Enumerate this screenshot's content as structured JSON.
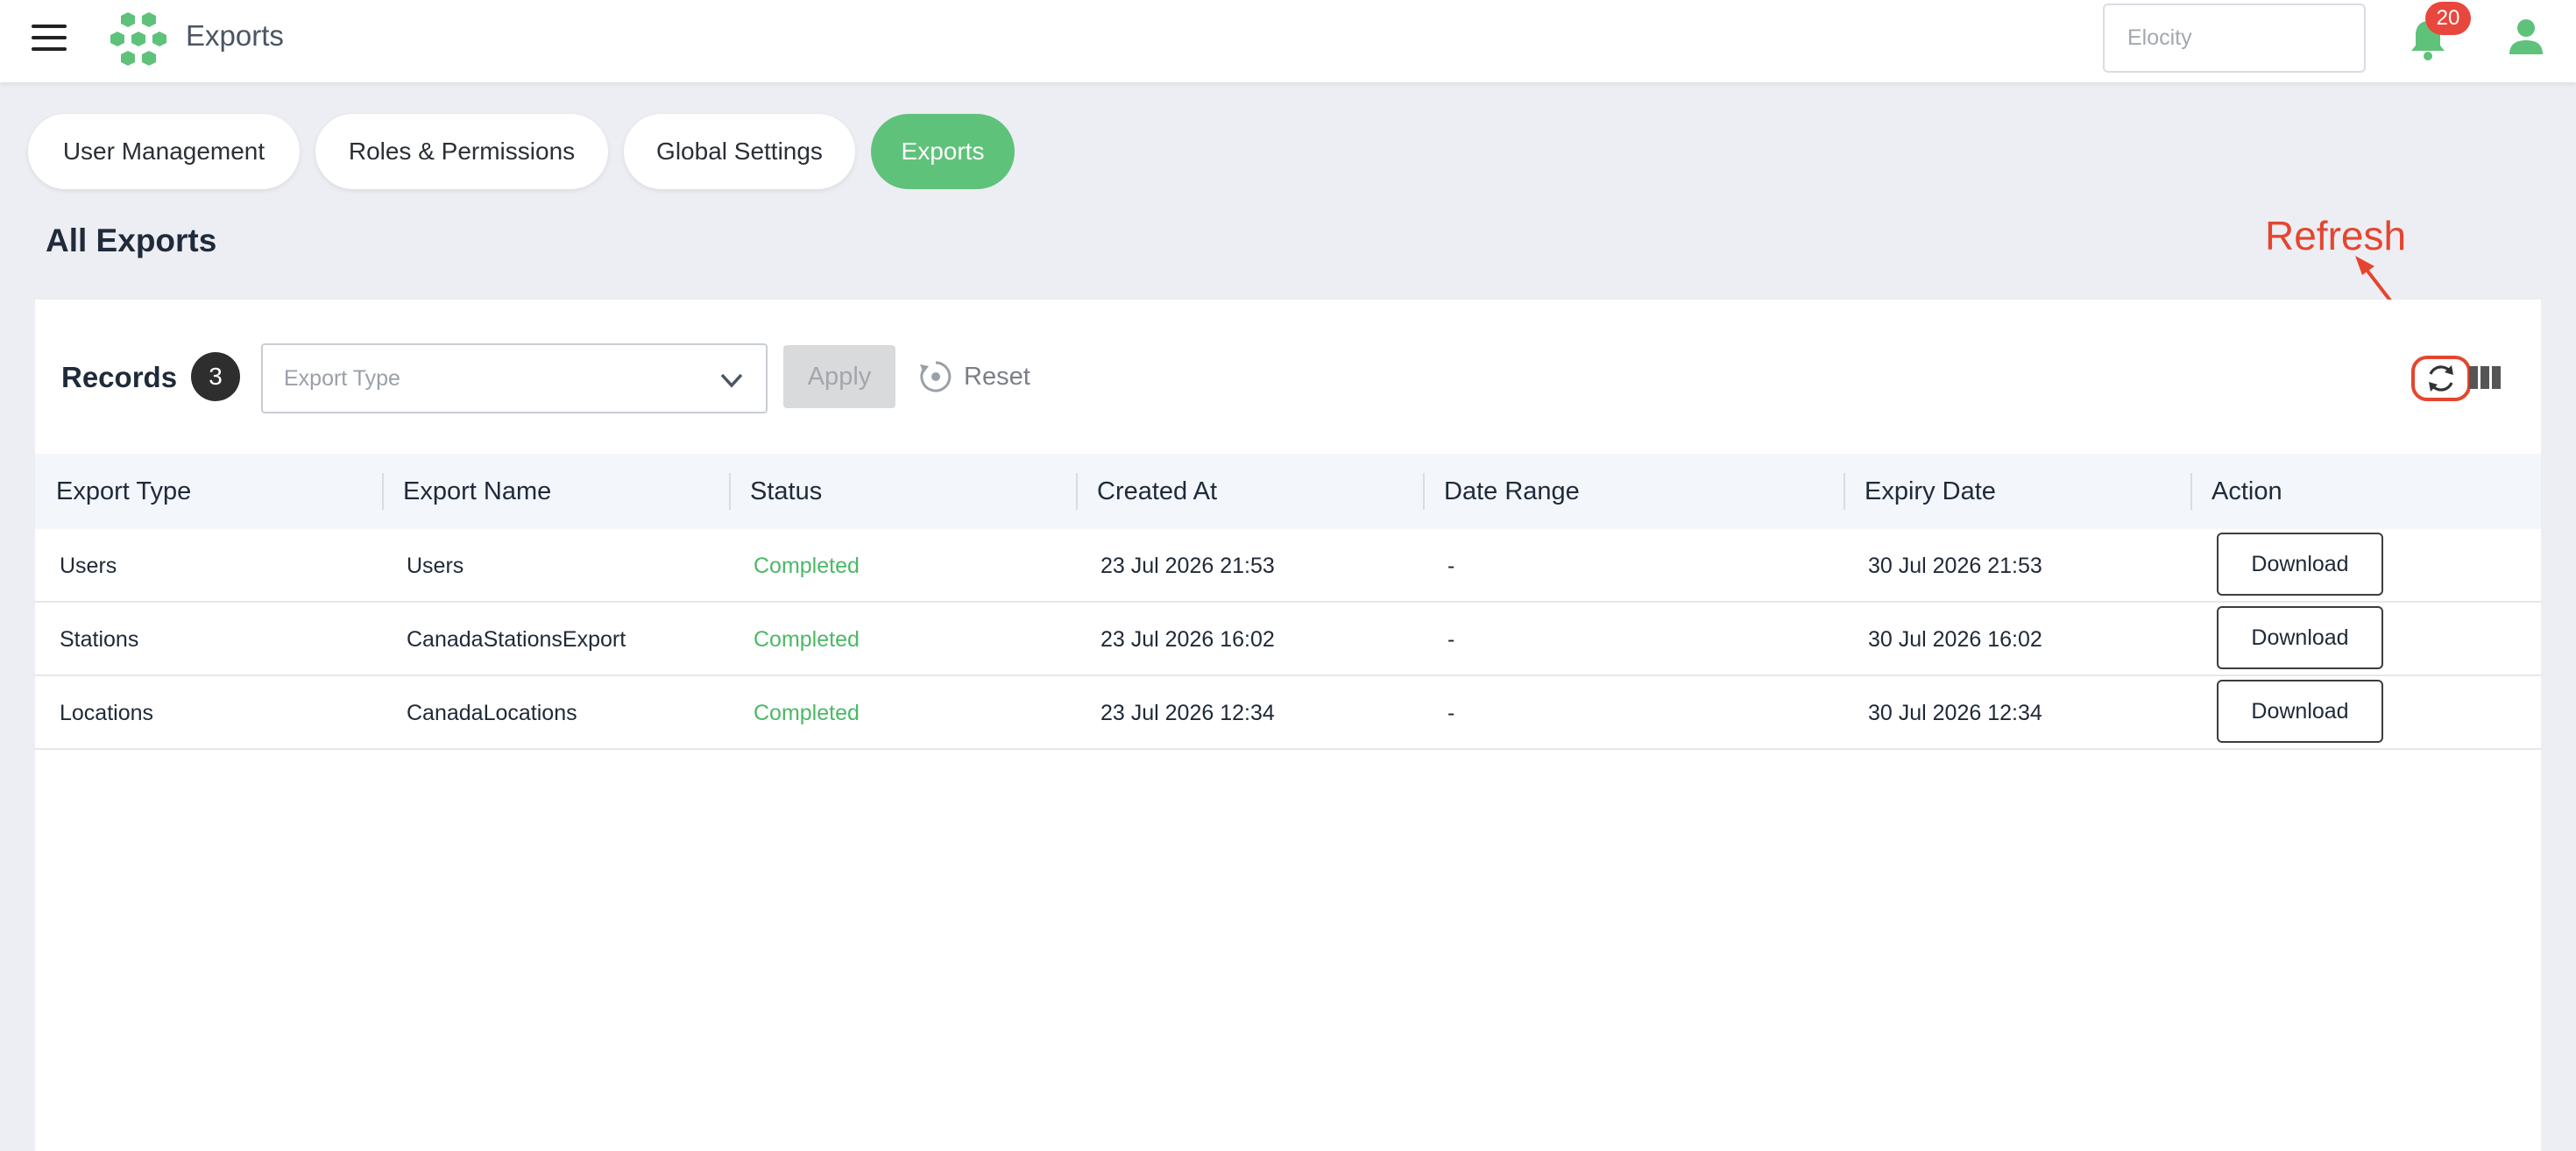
{
  "header": {
    "title": "Exports",
    "search_placeholder": "Elocity",
    "notification_count": "20",
    "logo_color": "#5fc27a"
  },
  "tabs": [
    {
      "label": "User Management",
      "active": false
    },
    {
      "label": "Roles & Permissions",
      "active": false
    },
    {
      "label": "Global Settings",
      "active": false
    },
    {
      "label": "Exports",
      "active": true
    }
  ],
  "page_title": "All Exports",
  "annotation": {
    "label": "Refresh",
    "color": "#e5452f"
  },
  "toolbar": {
    "records_label": "Records",
    "records_count": "3",
    "filter_placeholder": "Export Type",
    "apply_label": "Apply",
    "reset_label": "Reset"
  },
  "table": {
    "columns": [
      "Export Type",
      "Export Name",
      "Status",
      "Created At",
      "Date Range",
      "Expiry Date",
      "Action"
    ],
    "rows": [
      {
        "export_type": "Users",
        "export_name": "Users",
        "status": "Completed",
        "created_at": "23 Jul 2026 21:53",
        "date_range": "-",
        "expiry_date": "30 Jul 2026 21:53",
        "action": "Download"
      },
      {
        "export_type": "Stations",
        "export_name": "CanadaStationsExport",
        "status": "Completed",
        "created_at": "23 Jul 2026 16:02",
        "date_range": "-",
        "expiry_date": "30 Jul 2026 16:02",
        "action": "Download"
      },
      {
        "export_type": "Locations",
        "export_name": "CanadaLocations",
        "status": "Completed",
        "created_at": "23 Jul 2026 12:34",
        "date_range": "-",
        "expiry_date": "30 Jul 2026 12:34",
        "action": "Download"
      }
    ]
  },
  "colors": {
    "accent": "#5fc27a",
    "status_completed": "#4cb866",
    "badge": "#e8473d"
  }
}
